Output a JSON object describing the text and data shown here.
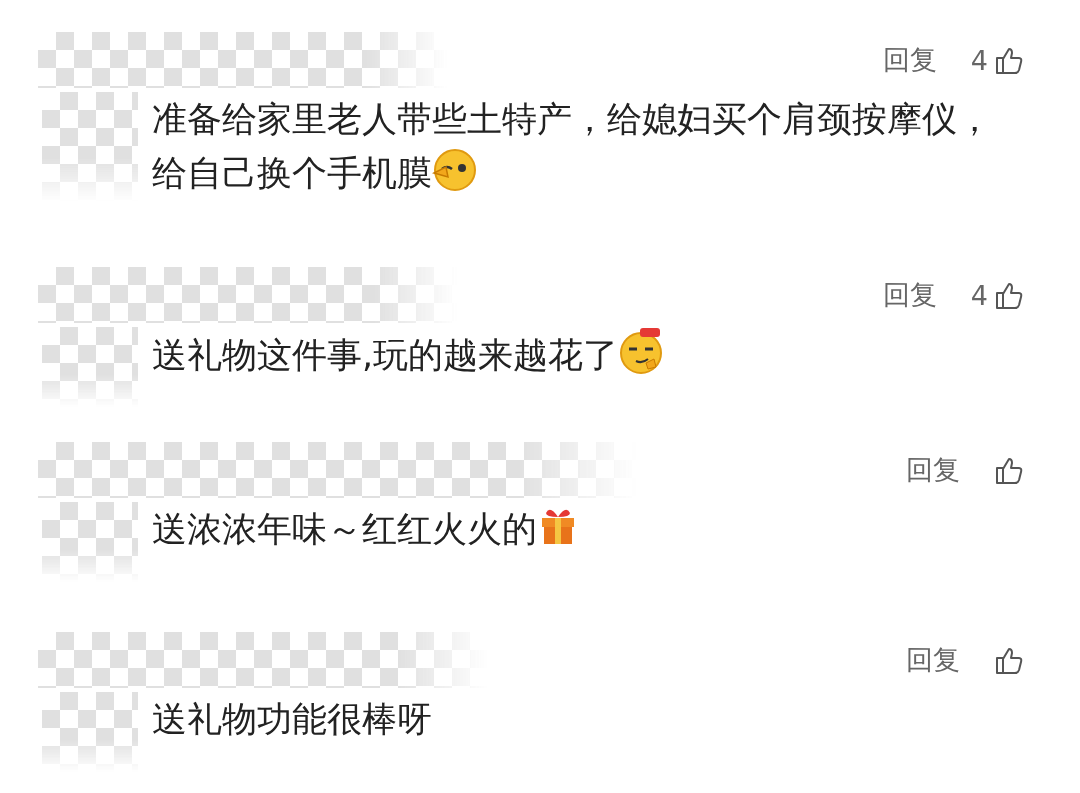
{
  "comments": [
    {
      "reply": "回复",
      "likes": "4",
      "text": "准备给家里老人带些土特产，给媳妇买个肩颈按摩仪，给自己换个手机膜",
      "kind": "wink"
    },
    {
      "reply": "回复",
      "likes": "4",
      "text": "送礼物这件事,玩的越来越花了",
      "kind": "smirk"
    },
    {
      "reply": "回复",
      "text": "送浓浓年味～红红火火的",
      "kind": "gift"
    },
    {
      "reply": "回复",
      "text": "送礼物功能很棒呀",
      "kind": "plain"
    }
  ]
}
